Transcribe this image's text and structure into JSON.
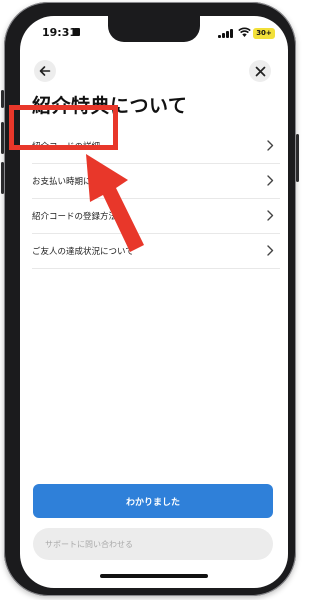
{
  "status_bar": {
    "time": "19:31",
    "battery": "30+"
  },
  "page": {
    "title": "紹介特典について"
  },
  "list": {
    "items": [
      {
        "label": "紹介コードの詳細"
      },
      {
        "label": "お支払い時期について"
      },
      {
        "label": "紹介コードの登録方法"
      },
      {
        "label": "ご友人の達成状況について"
      }
    ]
  },
  "buttons": {
    "primary_label": "わかりました",
    "secondary_label": "サポートに問い合わせる"
  },
  "icons": {
    "back": "arrow-left-icon",
    "close": "close-icon",
    "chevron": "chevron-right-icon"
  },
  "colors": {
    "primary": "#2f80d9",
    "annotation": "#e8372a",
    "battery": "#f2e03a"
  }
}
